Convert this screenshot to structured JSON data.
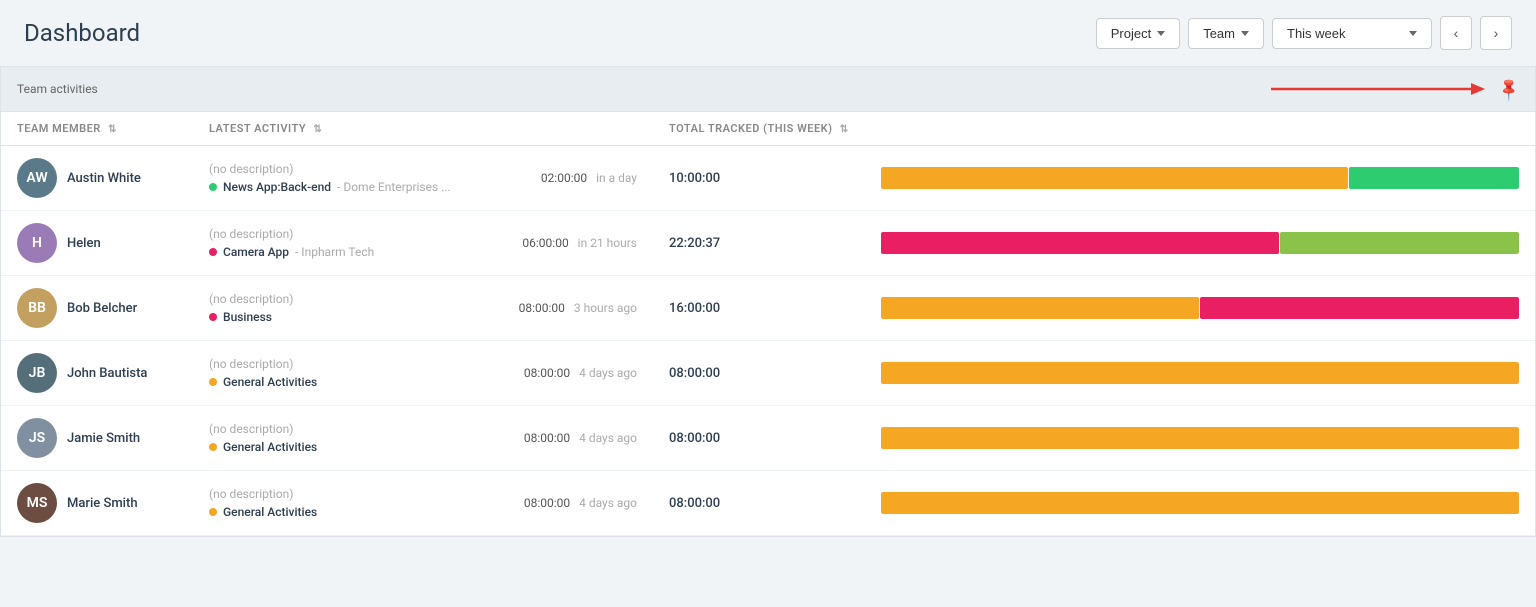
{
  "header": {
    "title": "Dashboard",
    "project_label": "Project",
    "team_label": "Team",
    "week_label": "This week"
  },
  "panel": {
    "title": "Team activities",
    "columns": {
      "member": "TEAM MEMBER",
      "activity": "LATEST ACTIVITY",
      "tracked": "TOTAL TRACKED (THIS WEEK)"
    }
  },
  "members": [
    {
      "name": "Austin White",
      "avatar_color": "#5a6e7f",
      "avatar_initials": "AW",
      "activity_desc": "(no description)",
      "project_name": "News App:Back-end",
      "project_client": "Dome Enterprises ...",
      "project_dot_color": "#2ecc71",
      "time_value": "02:00:00",
      "time_ago": "in a day",
      "tracked": "10:00:00",
      "bars": [
        {
          "color": "#f5a623",
          "flex": 55
        },
        {
          "color": "#2ecc71",
          "flex": 20
        }
      ]
    },
    {
      "name": "Helen",
      "avatar_color": "#a78bbd",
      "avatar_initials": "H",
      "activity_desc": "(no description)",
      "project_name": "Camera App",
      "project_client": "Inpharm Tech",
      "project_dot_color": "#e91e63",
      "time_value": "06:00:00",
      "time_ago": "in 21 hours",
      "tracked": "22:20:37",
      "bars": [
        {
          "color": "#e91e63",
          "flex": 75
        },
        {
          "color": "#8bc34a",
          "flex": 45
        }
      ]
    },
    {
      "name": "Bob Belcher",
      "avatar_color": "#c8a96e",
      "avatar_initials": "BB",
      "activity_desc": "(no description)",
      "project_name": "Business",
      "project_client": "",
      "project_dot_color": "#e91e63",
      "time_value": "08:00:00",
      "time_ago": "3 hours ago",
      "tracked": "16:00:00",
      "bars": [
        {
          "color": "#f5a623",
          "flex": 55
        },
        {
          "color": "#e91e63",
          "flex": 55
        }
      ]
    },
    {
      "name": "John Bautista",
      "avatar_color": "#607d8b",
      "avatar_initials": "JB",
      "activity_desc": "(no description)",
      "project_name": "General Activities",
      "project_client": "",
      "project_dot_color": "#f5a623",
      "time_value": "08:00:00",
      "time_ago": "4 days ago",
      "tracked": "08:00:00",
      "bars": [
        {
          "color": "#f5a623",
          "flex": 55
        }
      ]
    },
    {
      "name": "Jamie Smith",
      "avatar_color": "#90a4ae",
      "avatar_initials": "JS",
      "activity_desc": "(no description)",
      "project_name": "General Activities",
      "project_client": "",
      "project_dot_color": "#f5a623",
      "time_value": "08:00:00",
      "time_ago": "4 days ago",
      "tracked": "08:00:00",
      "bars": [
        {
          "color": "#f5a623",
          "flex": 55
        }
      ]
    },
    {
      "name": "Marie Smith",
      "avatar_color": "#795548",
      "avatar_initials": "MS",
      "activity_desc": "(no description)",
      "project_name": "General Activities",
      "project_client": "",
      "project_dot_color": "#f5a623",
      "time_value": "08:00:00",
      "time_ago": "4 days ago",
      "tracked": "08:00:00",
      "bars": [
        {
          "color": "#f5a623",
          "flex": 55
        }
      ]
    }
  ]
}
